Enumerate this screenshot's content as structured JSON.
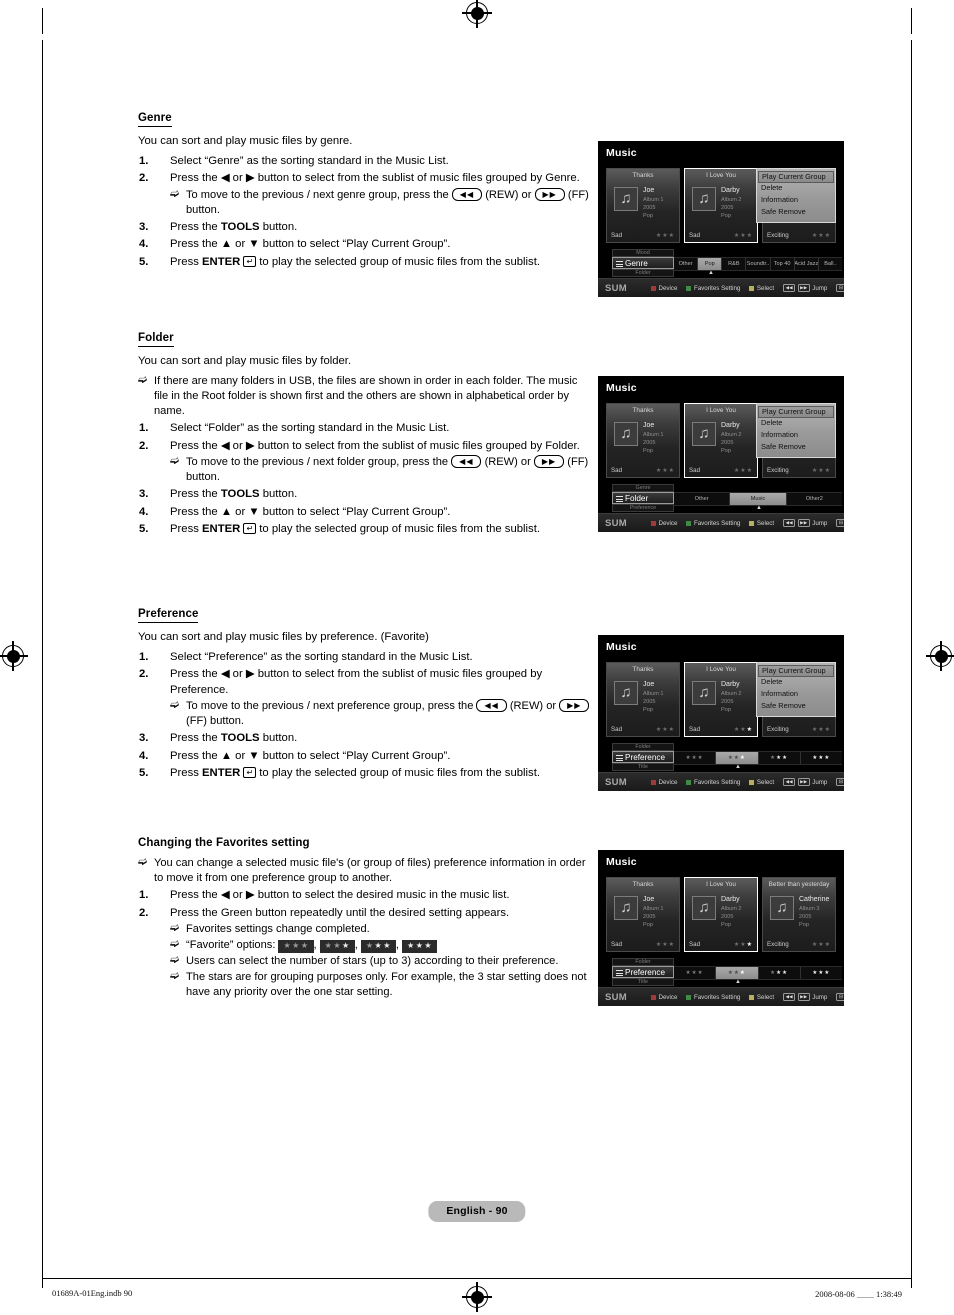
{
  "page": {
    "footer_pill": "English - 90",
    "footer_left": "01689A-01Eng.indb   90",
    "footer_right": "2008-08-06   ＿＿ 1:38:49"
  },
  "sections": [
    {
      "heading": "Genre",
      "lead": "You can sort and play music files by genre.",
      "steps": [
        {
          "num": "1.",
          "text": "Select “Genre” as the sorting standard in the Music List."
        },
        {
          "num": "2.",
          "text_a": "Press the ◀ or ▶ button to select from the sublist of music files grouped by Genre.",
          "notes": [
            {
              "a": "To move to the previous / next genre group, press the ",
              "key1": "◀◀",
              "b": " (REW) or ",
              "key2": "▶▶",
              "c": " (FF) button."
            }
          ]
        },
        {
          "num": "3.",
          "text_pre": "Press the ",
          "bold": "TOOLS",
          "text_post": " button."
        },
        {
          "num": "4.",
          "text": "Press the ▲ or ▼ button to select “Play Current Group”."
        },
        {
          "num": "5.",
          "text_pre": "Press ",
          "bold": "ENTER",
          "text_post": " to play the selected group of music files from the sublist."
        }
      ]
    },
    {
      "heading": "Folder",
      "lead": "You can sort and play music files by folder.",
      "top_notes": [
        "If there are many folders in USB, the files are shown in order in each folder. The music file in the Root folder is shown first and the others are shown in alphabetical order by name."
      ],
      "steps": [
        {
          "num": "1.",
          "text": "Select “Folder” as the sorting standard in the Music List."
        },
        {
          "num": "2.",
          "text_a": "Press the ◀ or ▶ button to select from the sublist of music files grouped by Folder.",
          "notes": [
            {
              "a": "To move to the previous / next folder group, press the ",
              "key1": "◀◀",
              "b": " (REW) or ",
              "key2": "▶▶",
              "c": " (FF) button."
            }
          ]
        },
        {
          "num": "3.",
          "text_pre": "Press the ",
          "bold": "TOOLS",
          "text_post": " button."
        },
        {
          "num": "4.",
          "text": "Press the ▲ or ▼ button to select “Play Current Group”."
        },
        {
          "num": "5.",
          "text_pre": "Press ",
          "bold": "ENTER",
          "text_post": " to play the selected group of music files from the sublist."
        }
      ]
    },
    {
      "heading": "Preference",
      "lead": "You can sort and play music files by preference. (Favorite)",
      "steps": [
        {
          "num": "1.",
          "text": "Select “Preference” as the sorting standard in the Music List."
        },
        {
          "num": "2.",
          "text_a": "Press the ◀ or ▶ button to select from the sublist of music files grouped by Preference.",
          "notes": [
            {
              "a": "To move to the previous / next preference group, press the ",
              "key1": "◀◀",
              "b": " (REW) or ",
              "key2": "▶▶",
              "c": " (FF) button."
            }
          ]
        },
        {
          "num": "3.",
          "text_pre": "Press the ",
          "bold": "TOOLS",
          "text_post": " button."
        },
        {
          "num": "4.",
          "text": "Press the ▲ or ▼ button to select “Play Current Group”."
        },
        {
          "num": "5.",
          "text_pre": "Press ",
          "bold": "ENTER",
          "text_post": " to play the selected group of music files from the sublist."
        }
      ]
    },
    {
      "heading": "Changing the Favorites setting",
      "no_rule": true,
      "top_notes": [
        "You can change a selected music file's (or group of files) preference information in order to move it from one preference group to another."
      ],
      "steps": [
        {
          "num": "1.",
          "text": "Press the ◀ or ▶ button to select the desired music in the music list."
        },
        {
          "num": "2.",
          "text_a": "Press the Green button repeatedly until the desired setting appears.",
          "notes": [
            {
              "a": "Favorites settings change completed."
            },
            {
              "favorite_options_label": "“Favorite” options: ",
              "options": [
                0,
                1,
                2,
                3
              ]
            },
            {
              "a": "Users can select the number of stars (up to 3) according to their preference."
            },
            {
              "a": "The stars are for grouping purposes only. For example, the 3 star setting does not have any priority over the one star setting."
            }
          ]
        }
      ]
    }
  ],
  "screens": [
    {
      "id": "genre",
      "title": "Music",
      "cards": [
        {
          "title": "Thanks",
          "artist": "Joe",
          "album": "Album 1",
          "year": "2005",
          "genre": "Pop",
          "mood": "Sad",
          "stars": 0,
          "selected": false
        },
        {
          "title": "I Love You",
          "artist": "Darby",
          "album": "Album 2",
          "year": "2005",
          "genre": "Pop",
          "mood": "Sad",
          "stars": 0,
          "selected": true
        },
        {
          "title": "",
          "artist": "",
          "album": "",
          "year": "",
          "genre": "",
          "mood": "Exciting",
          "stars": 0,
          "selected": false
        }
      ],
      "tools_menu": {
        "items": [
          "Play Current Group",
          "Delete",
          "Information",
          "Safe Remove"
        ],
        "highlighted": 0
      },
      "sort": {
        "prev": "Mood",
        "current": "Genre",
        "next": "Folder"
      },
      "sublist": {
        "type": "text",
        "cells": [
          "Other",
          "Pop",
          "R&B",
          "Soundtr..",
          "Top 40",
          "Acid Jazz",
          "Ball.."
        ],
        "active": 1
      },
      "helpbar": {
        "sum": "SUM",
        "items": [
          {
            "swatch": "red",
            "label": "Device"
          },
          {
            "swatch": "green",
            "label": "Favorites Setting"
          },
          {
            "swatch": "yellow",
            "label": "Select"
          },
          {
            "keys": [
              "◀◀",
              "▶▶"
            ],
            "label": "Jump"
          },
          {
            "icon": "option-icon",
            "label": "Option"
          }
        ]
      }
    },
    {
      "id": "folder",
      "title": "Music",
      "cards": [
        {
          "title": "Thanks",
          "artist": "Joe",
          "album": "Album 1",
          "year": "2005",
          "genre": "Pop",
          "mood": "Sad",
          "stars": 0,
          "selected": false
        },
        {
          "title": "I Love You",
          "artist": "Darby",
          "album": "Album 2",
          "year": "2005",
          "genre": "Pop",
          "mood": "Sad",
          "stars": 0,
          "selected": true
        },
        {
          "title": "",
          "artist": "",
          "album": "",
          "year": "",
          "genre": "",
          "mood": "Exciting",
          "stars": 0,
          "selected": false
        }
      ],
      "tools_menu": {
        "items": [
          "Play Current Group",
          "Delete",
          "Information",
          "Safe Remove"
        ],
        "highlighted": 0
      },
      "sort": {
        "prev": "Genre",
        "current": "Folder",
        "next": "Preference"
      },
      "sublist": {
        "type": "text",
        "cells": [
          "Other",
          "Music",
          "Other2"
        ],
        "active": 1
      },
      "helpbar": {
        "sum": "SUM",
        "items": [
          {
            "swatch": "red",
            "label": "Device"
          },
          {
            "swatch": "green",
            "label": "Favorites Setting"
          },
          {
            "swatch": "yellow",
            "label": "Select"
          },
          {
            "keys": [
              "◀◀",
              "▶▶"
            ],
            "label": "Jump"
          },
          {
            "icon": "option-icon",
            "label": "Option"
          }
        ]
      }
    },
    {
      "id": "preference",
      "title": "Music",
      "cards": [
        {
          "title": "Thanks",
          "artist": "Joe",
          "album": "Album 1",
          "year": "2005",
          "genre": "Pop",
          "mood": "Sad",
          "stars": 0,
          "selected": false
        },
        {
          "title": "I Love You",
          "artist": "Darby",
          "album": "Album 2",
          "year": "2005",
          "genre": "Pop",
          "mood": "Sad",
          "stars": 1,
          "selected": true
        },
        {
          "title": "",
          "artist": "",
          "album": "",
          "year": "",
          "genre": "",
          "mood": "Exciting",
          "stars": 0,
          "selected": false
        }
      ],
      "tools_menu": {
        "items": [
          "Play Current Group",
          "Delete",
          "Information",
          "Safe Remove"
        ],
        "highlighted": 0
      },
      "sort": {
        "prev": "Folder",
        "current": "Preference",
        "next": "Title"
      },
      "sublist": {
        "type": "stars",
        "cells": [
          0,
          1,
          2,
          3
        ],
        "active": 1
      },
      "helpbar": {
        "sum": "SUM",
        "items": [
          {
            "swatch": "red",
            "label": "Device"
          },
          {
            "swatch": "green",
            "label": "Favorites Setting"
          },
          {
            "swatch": "yellow",
            "label": "Select"
          },
          {
            "keys": [
              "◀◀",
              "▶▶"
            ],
            "label": "Jump"
          },
          {
            "icon": "option-icon",
            "label": "Option"
          }
        ]
      }
    },
    {
      "id": "favorites",
      "title": "Music",
      "cards": [
        {
          "title": "Thanks",
          "artist": "Joe",
          "album": "Album 1",
          "year": "2005",
          "genre": "Pop",
          "mood": "Sad",
          "stars": 0,
          "selected": false
        },
        {
          "title": "I Love You",
          "artist": "Darby",
          "album": "Album 2",
          "year": "2005",
          "genre": "Pop",
          "mood": "Sad",
          "stars": 1,
          "selected": true
        },
        {
          "title": "Better than yesterday",
          "artist": "Catherine",
          "album": "Album 3",
          "year": "2005",
          "genre": "Pop",
          "mood": "Exciting",
          "stars": 0,
          "selected": false
        }
      ],
      "tools_menu": null,
      "sort": {
        "prev": "Folder",
        "current": "Preference",
        "next": "Title"
      },
      "sublist": {
        "type": "stars",
        "cells": [
          0,
          1,
          2,
          3
        ],
        "active": 1
      },
      "helpbar": {
        "sum": "SUM",
        "items": [
          {
            "swatch": "red",
            "label": "Device"
          },
          {
            "swatch": "green",
            "label": "Favorites Setting"
          },
          {
            "swatch": "yellow",
            "label": "Select"
          },
          {
            "keys": [
              "◀◀",
              "▶▶"
            ],
            "label": "Jump"
          },
          {
            "icon": "option-icon",
            "label": "Option"
          }
        ]
      }
    }
  ]
}
